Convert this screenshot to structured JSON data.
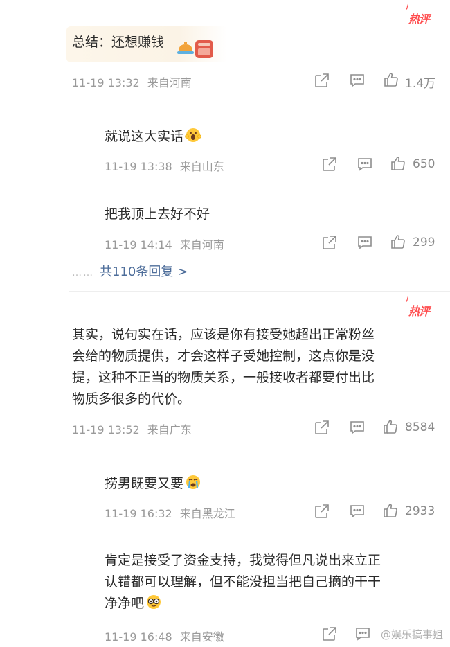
{
  "hot_badge_label": "热评",
  "comments": [
    {
      "text": "总结：还想赚钱",
      "date": "11-19 13:32",
      "location": "来自河南",
      "likes": "1.4万"
    },
    {
      "text": "其实，说句实在话，应该是你有接受她超出正常粉丝会给的物质提供，才会这样子受她控制，这点你是没提，这种不正当的物质关系，一般接收者都要付出比物质多很多的代价。",
      "lines": [
        "其实，说句实在话，应该是你有接受她超出正常粉丝",
        "会给的物质提供，才会这样子受她控制，这点你是没",
        "提，这种不正当的物质关系，一般接收者都要付出比",
        "物质多很多的代价。"
      ],
      "date": "11-19 13:52",
      "location": "来自广东",
      "likes": "8584"
    }
  ],
  "replies": [
    {
      "text": "就说这大实话",
      "emoji": "scream-face-emoji",
      "date": "11-19 13:38",
      "location": "来自山东",
      "likes": "650"
    },
    {
      "text": "把我顶上去好不好",
      "date": "11-19 14:14",
      "location": "来自河南",
      "likes": "299"
    },
    {
      "text": "捞男既要又要",
      "emoji": "crying-face-emoji",
      "date": "11-19 16:32",
      "location": "来自黑龙江",
      "likes": "2933"
    },
    {
      "lines": [
        "肯定是接受了资金支持，我觉得但凡说出来立正",
        "认错都可以理解，但不能没担当把自己摘的干干",
        "净净吧"
      ],
      "emoji": "nerd-glasses-emoji",
      "date": "11-19 16:48",
      "location": "来自安徽"
    }
  ],
  "more_replies": {
    "dots": "……",
    "label": "共110条回复 >"
  },
  "watermark": "@娱乐搞事姐",
  "colors": {
    "hot_badge": "#ff4d4f",
    "link_blue": "#4d6d9a",
    "meta_gray": "#9a9a9a",
    "text_dark": "#2a2a2a"
  }
}
